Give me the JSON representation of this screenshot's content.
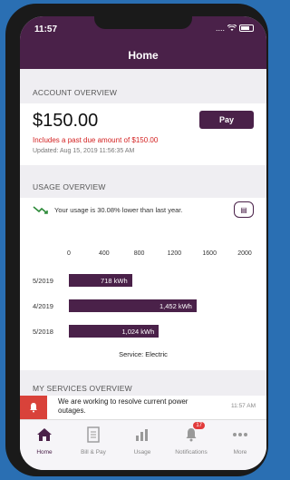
{
  "status_bar": {
    "time": "11:57",
    "signal": "....",
    "wifi": "wifi"
  },
  "header": {
    "title": "Home"
  },
  "account_overview": {
    "section_label": "ACCOUNT OVERVIEW",
    "amount": "$150.00",
    "pay_label": "Pay",
    "past_due": "Includes a past due amount of $150.00",
    "updated": "Updated: Aug 15, 2019 11:56:35 AM"
  },
  "usage_overview": {
    "section_label": "USAGE OVERVIEW",
    "summary": "Your usage is 30.08% lower than last year.",
    "service": "Service: Electric"
  },
  "chart_data": {
    "type": "bar",
    "orientation": "horizontal",
    "categories": [
      "5/2019",
      "4/2019",
      "5/2018"
    ],
    "values": [
      718,
      1452,
      1024
    ],
    "value_labels": [
      "718 kWh",
      "1,452 kWh",
      "1,024 kWh"
    ],
    "unit": "kWh",
    "x_ticks": [
      "0",
      "400",
      "800",
      "1200",
      "1600",
      "2000"
    ],
    "xlim": [
      0,
      2000
    ],
    "color": "#4a2149"
  },
  "services_overview": {
    "section_label": "MY SERVICES OVERVIEW",
    "alert_text": "We are working to resolve current power outages.",
    "alert_time": "11:57 AM"
  },
  "tabs": [
    {
      "label": "Home",
      "icon": "home-icon",
      "active": true
    },
    {
      "label": "Bill & Pay",
      "icon": "bill-icon",
      "active": false
    },
    {
      "label": "Usage",
      "icon": "usage-icon",
      "active": false
    },
    {
      "label": "Notifications",
      "icon": "bell-icon",
      "active": false,
      "badge": "17"
    },
    {
      "label": "More",
      "icon": "more-icon",
      "active": false
    }
  ],
  "colors": {
    "brand": "#4a2149",
    "alert": "#d9423a",
    "past_due": "#d32222",
    "background": "#efeef2"
  }
}
